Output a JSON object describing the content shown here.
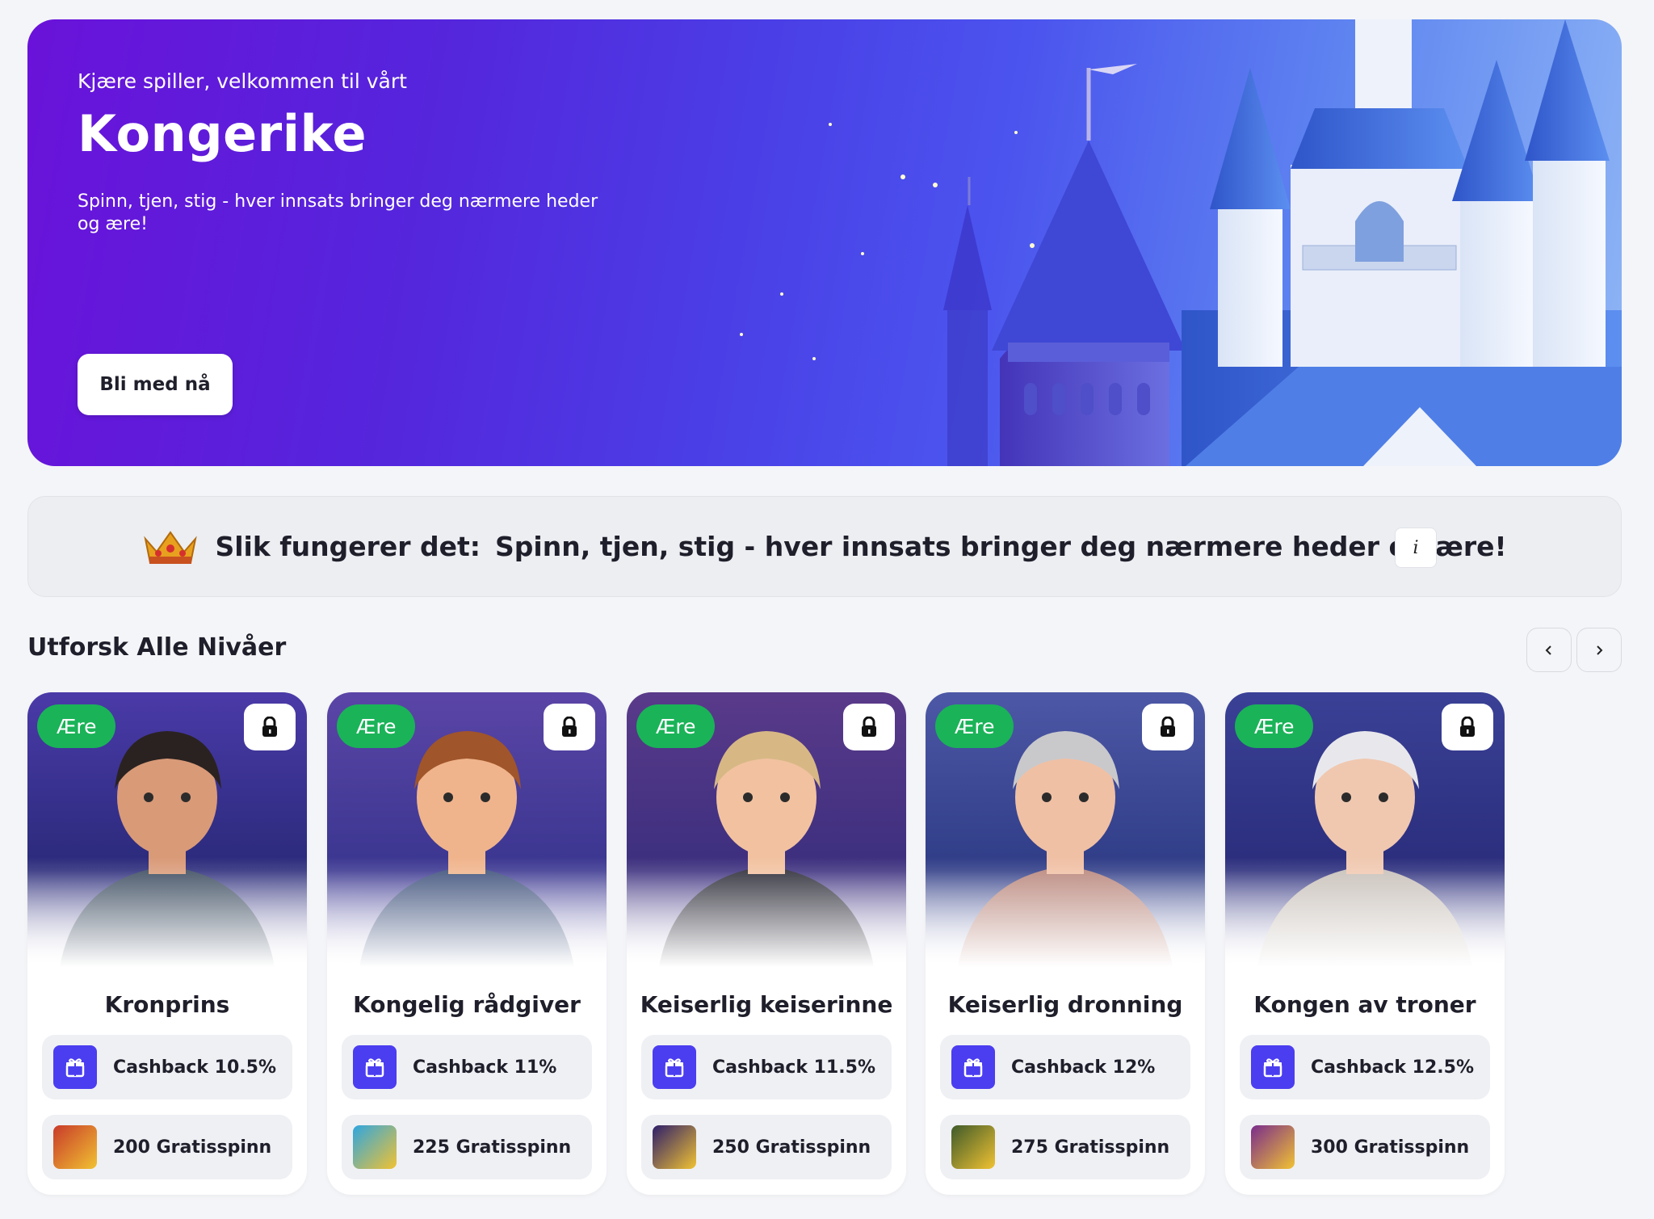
{
  "hero": {
    "subtitle": "Kjære spiller, velkommen til vårt",
    "title": "Kongerike",
    "description": "Spinn, tjen, stig - hver innsats bringer deg nærmere heder og ære!",
    "cta_label": "Bli med nå"
  },
  "how": {
    "label": "Slik fungerer det:",
    "text": "Spinn, tjen, stig - hver innsats bringer deg nærmere heder og ære!",
    "info_label": "i",
    "icon": "crown-icon"
  },
  "levels": {
    "title": "Utforsk Alle Nivåer",
    "prev_icon": "chevron-left-icon",
    "next_icon": "chevron-right-icon",
    "cards": [
      {
        "badge": "Ære",
        "name": "Kronprins",
        "cashback": "Cashback 10.5%",
        "spins": "200 Gratisspinn",
        "thumb_color": "#c83a2a"
      },
      {
        "badge": "Ære",
        "name": "Kongelig rådgiver",
        "cashback": "Cashback 11%",
        "spins": "225 Gratisspinn",
        "thumb_color": "#2fa6e0"
      },
      {
        "badge": "Ære",
        "name": "Keiserlig keiserinne",
        "cashback": "Cashback 11.5%",
        "spins": "250 Gratisspinn",
        "thumb_color": "#2d1e6b"
      },
      {
        "badge": "Ære",
        "name": "Keiserlig dronning",
        "cashback": "Cashback 12%",
        "spins": "275 Gratisspinn",
        "thumb_color": "#3e5a2a"
      },
      {
        "badge": "Ære",
        "name": "Kongen av troner",
        "cashback": "Cashback 12.5%",
        "spins": "300 Gratisspinn",
        "thumb_color": "#7a2c8c"
      }
    ]
  },
  "colors": {
    "accent": "#4b3df0",
    "badge": "#1ab358",
    "hero_start": "#6a12d9",
    "hero_end": "#8fb6f5"
  }
}
